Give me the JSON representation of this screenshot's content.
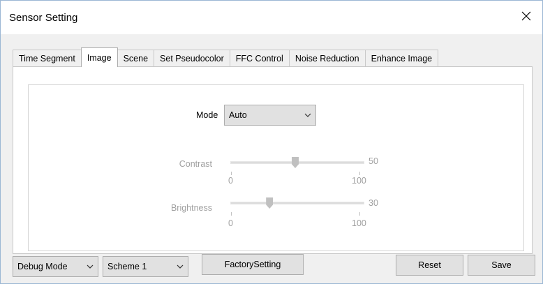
{
  "window": {
    "title": "Sensor Setting"
  },
  "tabs": [
    {
      "label": "Time Segment"
    },
    {
      "label": "Image",
      "active": true
    },
    {
      "label": "Scene"
    },
    {
      "label": "Set Pseudocolor"
    },
    {
      "label": "FFC Control"
    },
    {
      "label": "Noise Reduction"
    },
    {
      "label": "Enhance Image"
    }
  ],
  "image_panel": {
    "mode_label": "Mode",
    "mode_value": "Auto",
    "contrast": {
      "label": "Contrast",
      "value": "50",
      "min_label": "0",
      "max_label": "100",
      "level": 50
    },
    "brightness": {
      "label": "Brightness",
      "value": "30",
      "min_label": "0",
      "max_label": "100",
      "level": 30
    }
  },
  "footer": {
    "debug_mode_value": "Debug Mode",
    "scheme_value": "Scheme 1",
    "factory_label": "FactorySetting",
    "reset_label": "Reset",
    "save_label": "Save"
  },
  "icons": {
    "close": "close-icon",
    "dropdown": "chevron-down-icon"
  }
}
